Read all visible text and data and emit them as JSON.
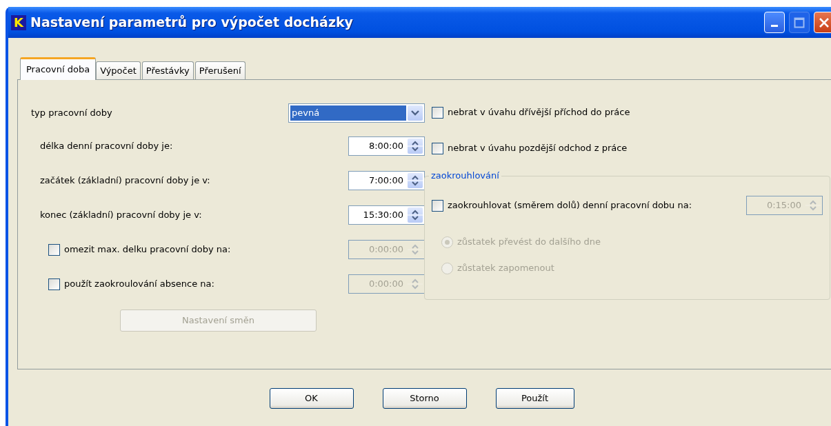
{
  "window": {
    "title": "Nastavení parametrů pro výpočet docházky",
    "app_letter": "K",
    "maximize_disabled": true
  },
  "tabs": [
    {
      "label": "Pracovní doba",
      "selected": true
    },
    {
      "label": "Výpočet",
      "selected": false
    },
    {
      "label": "Přestávky",
      "selected": false
    },
    {
      "label": "Přerušení",
      "selected": false
    }
  ],
  "work_type": {
    "label": "typ pracovní doby",
    "value": "pevná"
  },
  "fields": [
    {
      "kind": "spin",
      "label": "délka denní pracovní doby je:",
      "value": "8:00:00",
      "disabled": false
    },
    {
      "kind": "spin",
      "label": "začátek (základní) pracovní doby je v:",
      "value": "7:00:00",
      "disabled": false
    },
    {
      "kind": "spin",
      "label": "konec (základní) pracovní doby je v:",
      "value": "15:30:00",
      "disabled": false
    },
    {
      "kind": "check-spin",
      "label": "omezit max. delku pracovní doby na:",
      "checked": false,
      "value": "0:00:00",
      "disabled": true
    },
    {
      "kind": "check-spin",
      "label": "použít zaokroulování absence na:",
      "checked": false,
      "value": "0:00:00",
      "disabled": true
    }
  ],
  "shifts_button": {
    "label": "Nastavení směn",
    "disabled": true
  },
  "checks": [
    {
      "label": "nebrat v úvahu dřívější příchod do práce",
      "checked": false
    },
    {
      "label": "nebrat v úvahu pozdější odchod z práce",
      "checked": false
    }
  ],
  "rounding": {
    "title": "zaokrouhlování",
    "check": {
      "label": "zaokrouhlovat (směrem dolů) denní pracovní dobu na:",
      "checked": false
    },
    "spin": {
      "value": "0:15:00",
      "disabled": true
    },
    "options": [
      {
        "label": "zůstatek převést do dalšího dne",
        "selected": true,
        "disabled": true
      },
      {
        "label": "zůstatek zapomenout",
        "selected": false,
        "disabled": true
      }
    ]
  },
  "buttons": [
    "OK",
    "Storno",
    "Použít"
  ]
}
